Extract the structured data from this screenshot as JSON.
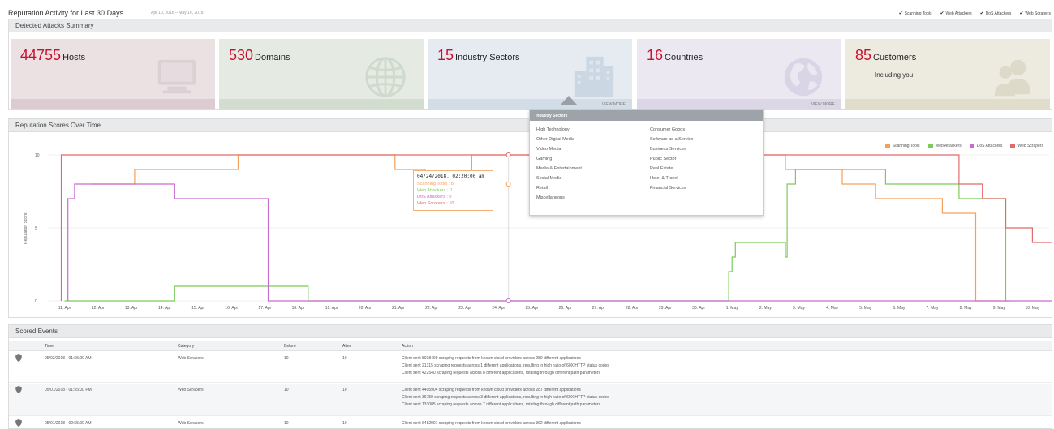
{
  "header": {
    "title": "Reputation Activity for Last 30 Days",
    "date_range": "Apr 10, 2018 – May 10, 2018",
    "toggles": [
      {
        "label": "Scanning Tools",
        "checked": true
      },
      {
        "label": "Web Attackers",
        "checked": true
      },
      {
        "label": "DoS Attackers",
        "checked": true
      },
      {
        "label": "Web Scrapers",
        "checked": true
      }
    ]
  },
  "summary": {
    "title": "Detected Attacks Summary",
    "cards": {
      "hosts": {
        "value": "44755",
        "label": "Hosts",
        "icon": "monitor-icon"
      },
      "domains": {
        "value": "530",
        "label": "Domains",
        "icon": "globe-icon"
      },
      "sectors": {
        "value": "15",
        "label": "Industry Sectors",
        "icon": "buildings-icon",
        "more": "VIEW MORE"
      },
      "countries": {
        "value": "16",
        "label": "Countries",
        "icon": "world-map-icon",
        "more": "VIEW MORE"
      },
      "customers": {
        "value": "85",
        "label": "Customers",
        "sub": "Including you",
        "icon": "users-icon"
      }
    }
  },
  "sectors_popover": {
    "title": "Industry Sectors",
    "col1": [
      "High Technology",
      "Other Digital Media",
      "Video Media",
      "Gaming",
      "Media & Entertainment",
      "Social Media",
      "Retail",
      "Miscellaneous"
    ],
    "col2": [
      "Consumer Goods",
      "Software as a Service",
      "Business Services",
      "Public Sector",
      "Real Estate",
      "Hotel & Travel",
      "Financial Services"
    ]
  },
  "chart_panel": {
    "title": "Reputation Scores Over Time"
  },
  "tooltip": {
    "time": "04/24/2018, 02:20:00 am",
    "lines": [
      {
        "label": "Scanning Tools : 8",
        "color": "#f5a05a"
      },
      {
        "label": "Web Attackers : 0",
        "color": "#7ccb5b"
      },
      {
        "label": "DoS Attackers : 0",
        "color": "#c86bcf"
      },
      {
        "label": "Web Scrapers : 10",
        "color": "#e06b6b"
      }
    ]
  },
  "chart_data": {
    "type": "line",
    "ylabel": "Reputation Score",
    "ylim": [
      0,
      10
    ],
    "y_ticks": [
      "0",
      "5",
      "10"
    ],
    "x": [
      "11. Apr",
      "12. Apr",
      "13. Apr",
      "14. Apr",
      "15. Apr",
      "16. Apr",
      "17. Apr",
      "18. Apr",
      "19. Apr",
      "20. Apr",
      "21. Apr",
      "22. Apr",
      "23. Apr",
      "24. Apr",
      "25. Apr",
      "26. Apr",
      "27. Apr",
      "28. Apr",
      "29. Apr",
      "30. Apr",
      "1. May",
      "2. May",
      "3. May",
      "4. May",
      "5. May",
      "6. May",
      "7. May",
      "8. May",
      "9. May",
      "10. May"
    ],
    "legend_position": "top-right",
    "series": [
      {
        "name": "Scanning Tools",
        "color": "#f5a05a",
        "points": [
          [
            0.8,
            8
          ],
          [
            2.1,
            8
          ],
          [
            2.1,
            9
          ],
          [
            5.2,
            9
          ],
          [
            5.2,
            10
          ],
          [
            9.9,
            10
          ],
          [
            9.9,
            9
          ],
          [
            10.8,
            9
          ],
          [
            10.8,
            8
          ],
          [
            12.2,
            8
          ],
          [
            12.2,
            10
          ],
          [
            21.6,
            10
          ],
          [
            21.6,
            9
          ],
          [
            23.3,
            9
          ],
          [
            23.3,
            8
          ],
          [
            24.3,
            8
          ],
          [
            24.3,
            7
          ],
          [
            26.3,
            7
          ],
          [
            26.3,
            6
          ],
          [
            27.3,
            6
          ],
          [
            27.3,
            0
          ],
          [
            28.2,
            0
          ],
          [
            28.2,
            0
          ]
        ]
      },
      {
        "name": "Web Attackers",
        "color": "#7ccb5b",
        "points": [
          [
            0,
            0
          ],
          [
            3.3,
            0
          ],
          [
            3.3,
            1
          ],
          [
            7.3,
            1
          ],
          [
            7.3,
            0
          ],
          [
            19.9,
            0
          ],
          [
            19.9,
            2
          ],
          [
            20.0,
            2
          ],
          [
            20.0,
            3
          ],
          [
            20.1,
            3
          ],
          [
            20.1,
            4
          ],
          [
            21.6,
            4
          ],
          [
            21.6,
            3
          ],
          [
            21.65,
            3
          ],
          [
            21.65,
            8
          ],
          [
            21.9,
            8
          ],
          [
            21.9,
            9
          ],
          [
            24.6,
            9
          ],
          [
            24.6,
            8
          ],
          [
            26.8,
            8
          ],
          [
            26.8,
            7
          ],
          [
            28.2,
            7
          ],
          [
            28.2,
            0
          ],
          [
            28.3,
            0
          ]
        ]
      },
      {
        "name": "DoS Attackers",
        "color": "#c86bcf",
        "points": [
          [
            0.1,
            0
          ],
          [
            0.1,
            7
          ],
          [
            0.3,
            7
          ],
          [
            0.3,
            8
          ],
          [
            3.3,
            8
          ],
          [
            3.3,
            7
          ],
          [
            6.1,
            7
          ],
          [
            6.1,
            0
          ],
          [
            30,
            0
          ]
        ]
      },
      {
        "name": "Web Scrapers",
        "color": "#e06b6b",
        "points": [
          [
            -0.1,
            0
          ],
          [
            -0.1,
            10
          ],
          [
            26.8,
            10
          ],
          [
            26.8,
            8
          ],
          [
            27.5,
            8
          ],
          [
            27.5,
            7
          ],
          [
            28.2,
            7
          ],
          [
            28.2,
            5
          ],
          [
            29.0,
            5
          ],
          [
            29.0,
            4
          ],
          [
            30,
            4
          ]
        ]
      }
    ],
    "crosshair_x": 13.3
  },
  "events": {
    "title": "Scored Events",
    "columns": [
      "Time",
      "Category",
      "Before",
      "After",
      "Action"
    ],
    "rows": [
      {
        "time": "05/02/2018 - 01:55:00 AM",
        "category": "Web Scrapers",
        "before": "10",
        "after": "10",
        "actions": [
          "Client sent 8038498 scraping requests from known cloud providers across 280 different applications",
          "Client sent 21315 scraping requests across 1 different applications, resulting in high ratio of 60X HTTP status codes",
          "Client sent 422540 scraping requests across 8 different applications, rotating through different path parameters"
        ]
      },
      {
        "time": "05/01/2018 - 01:55:00 PM",
        "category": "Web Scrapers",
        "before": "10",
        "after": "10",
        "actions": [
          "Client sent 4405904 scraping requests from known cloud providers across 287 different applications",
          "Client sent 36759 scraping requests across 3 different applications, resulting in high ratio of 60X HTTP status codes",
          "Client sent 133005 scraping requests across 7 different applications, rotating through different path parameters"
        ]
      },
      {
        "time": "05/01/2018 - 02:55:00 AM",
        "category": "Web Scrapers",
        "before": "10",
        "after": "10",
        "actions": [
          "Client sent 6482901 scraping requests from known cloud providers across 362 different applications"
        ]
      }
    ]
  }
}
